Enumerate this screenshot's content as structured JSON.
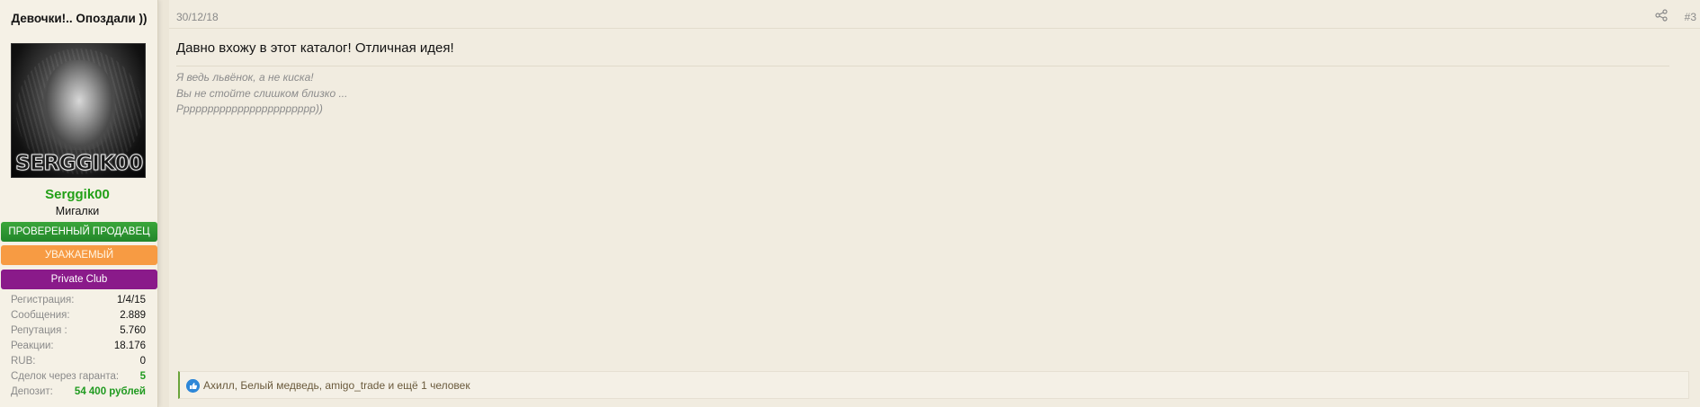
{
  "user": {
    "title": "Девочки!.. Опоздали ))",
    "avatar_watermark": "SERGGIK00",
    "username": "Serggik00",
    "user_title": "Мигалки",
    "banners": {
      "seller": "ПРОВЕРЕННЫЙ ПРОДАВЕЦ",
      "respected": "УВАЖАЕМЫЙ",
      "private": "Private Club"
    },
    "stats": [
      {
        "label": "Регистрация:",
        "value": "1/4/15"
      },
      {
        "label": "Сообщения:",
        "value": "2.889"
      },
      {
        "label": "Репутация :",
        "value": "5.760"
      },
      {
        "label": "Реакции:",
        "value": "18.176"
      },
      {
        "label": "RUB:",
        "value": "0"
      },
      {
        "label": "Сделок через гаранта:",
        "value": "5"
      },
      {
        "label": "Депозит:",
        "value": "54 400 рублей"
      }
    ]
  },
  "post": {
    "date": "30/12/18",
    "number": "#3",
    "message": "Давно вхожу в этот каталог! Отличная идея!",
    "signature": [
      "Я ведь львёнок, а не киска!",
      "Вы не стойте слишком близко ...",
      "Ррррррррррррррррррррррр))"
    ],
    "likes_text": "Ахилл, Белый медведь, amigo_trade и ещё 1 человек"
  },
  "colors": {
    "username": "#22a017",
    "seller_banner": "#2d962f",
    "respected_banner": "#f79b43",
    "private_banner": "#8a1a8a",
    "like_icon": "#2d87d8"
  },
  "icons": {
    "share": "share-icon",
    "like": "thumbs-up-icon"
  }
}
